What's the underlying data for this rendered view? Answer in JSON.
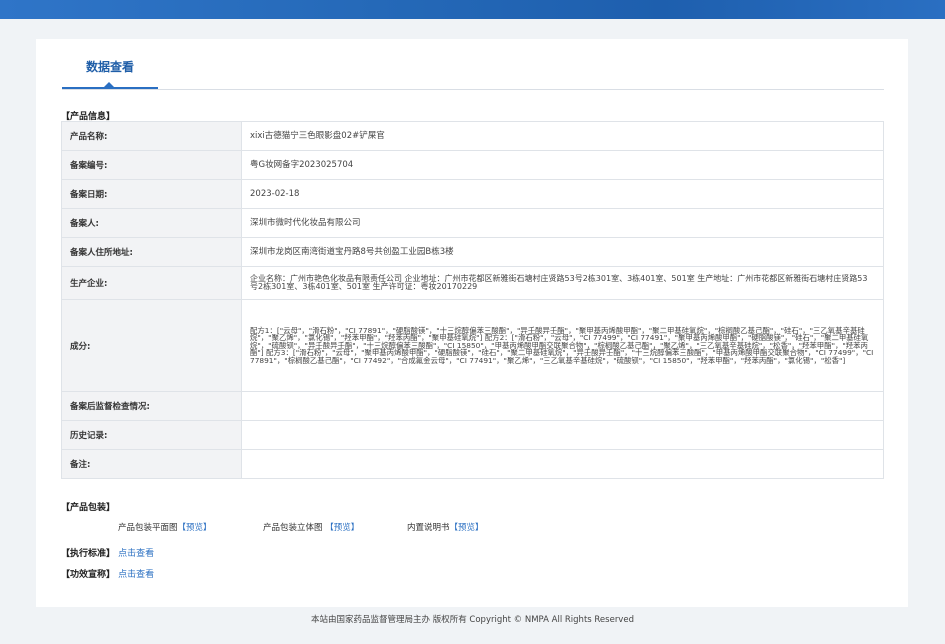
{
  "tab": {
    "label": "数据查看"
  },
  "product_info_title": "【产品信息】",
  "rows": [
    {
      "label": "产品名称:",
      "value": "xixi古德猫宁三色眼影盘02#铲屎官"
    },
    {
      "label": "备案编号:",
      "value": "粤G妆网备字2023025704"
    },
    {
      "label": "备案日期:",
      "value": "2023-02-18"
    },
    {
      "label": "备案人:",
      "value": "深圳市微时代化妆品有限公司"
    },
    {
      "label": "备案人住所地址:",
      "value": "深圳市龙岗区南湾街道宝丹路8号共创盈工业园B栋3楼"
    },
    {
      "label": "生产企业:",
      "value": "企业名称：广州市艳色化妆品有限责任公司 企业地址：广州市花都区新雅街石塘村庄贤路53号2栋301室、3栋401室、501室 生产地址：广州市花都区新雅街石塘村庄贤路53号2栋301室、3栋401室、501室 生产许可证：粤妆20170229"
    },
    {
      "label": "成分:",
      "value": "配方1：[\"云母\"，\"滑石粉\"，\"CI 77891\"，\"硬脂酸镁\"，\"十三烷醇偏苯三酸酯\"，\"异壬酸异壬酯\"，\"聚甲基丙烯酸甲酯\"，\"聚二甲基硅氧烷\"，\"棕榈酸乙基己酯\"，\"硅石\"，\"三乙氧基辛基硅烷\"，\"聚乙烯\"，\"氯化锡\"，\"羟苯甲酯\"，\"羟苯丙酯\"，\"聚甲基硅氧烷\"] 配方2：[\"滑石粉\"，\"云母\"，\"CI 77499\"，\"CI 77491\"，\"聚甲基丙烯酸甲酯\"，\"硬脂酸镁\"，\"硅石\"，\"聚二甲基硅氧烷\"，\"硫酸钡\"，\"异壬酸异壬酯\"，\"十三烷醇偏苯三酸酯\"，\"CI 15850\"，\"甲基丙烯酸甲酯交联聚合物\"，\"棕榈酸乙基己酯\"，\"聚乙烯\"，\"三乙氧基辛基硅烷\"，\"松香\"，\"羟苯甲酯\"，\"羟苯丙酯\"] 配方3：[\"滑石粉\"，\"云母\"，\"聚甲基丙烯酸甲酯\"，\"硬脂酸镁\"，\"硅石\"，\"聚二甲基硅氧烷\"，\"异壬酸异壬酯\"，\"十三烷醇偏苯三酸酯\"，\"甲基丙烯酸甲酯交联聚合物\"，\"CI 77499\"，\"CI 77891\"，\"棕榈酸乙基己酯\"，\"CI 77492\"，\"合成氟金云母\"，\"CI 77491\"，\"聚乙烯\"，\"三乙氧基辛基硅烷\"，\"硫酸钡\"，\"CI 15850\"，\"羟苯甲酯\"，\"羟苯丙酯\"，\"氯化锡\"，\"松香\"]"
    },
    {
      "label": "备案后监督检查情况:",
      "value": ""
    },
    {
      "label": "历史记录:",
      "value": ""
    },
    {
      "label": "备注:",
      "value": ""
    }
  ],
  "package": {
    "title": "【产品包装】",
    "items": [
      {
        "label": "产品包装平面图",
        "link": "【预览】"
      },
      {
        "label": "产品包装立体图",
        "link": "【预览】"
      },
      {
        "label": "内置说明书",
        "link": "【预览】"
      }
    ]
  },
  "standard": {
    "title": "【执行标准】",
    "link": "点击查看"
  },
  "claim": {
    "title": "【功效宣称】",
    "link": "点击查看"
  },
  "footer": "本站由国家药品监督管理局主办 版权所有 Copyright © NMPA All Rights Reserved"
}
